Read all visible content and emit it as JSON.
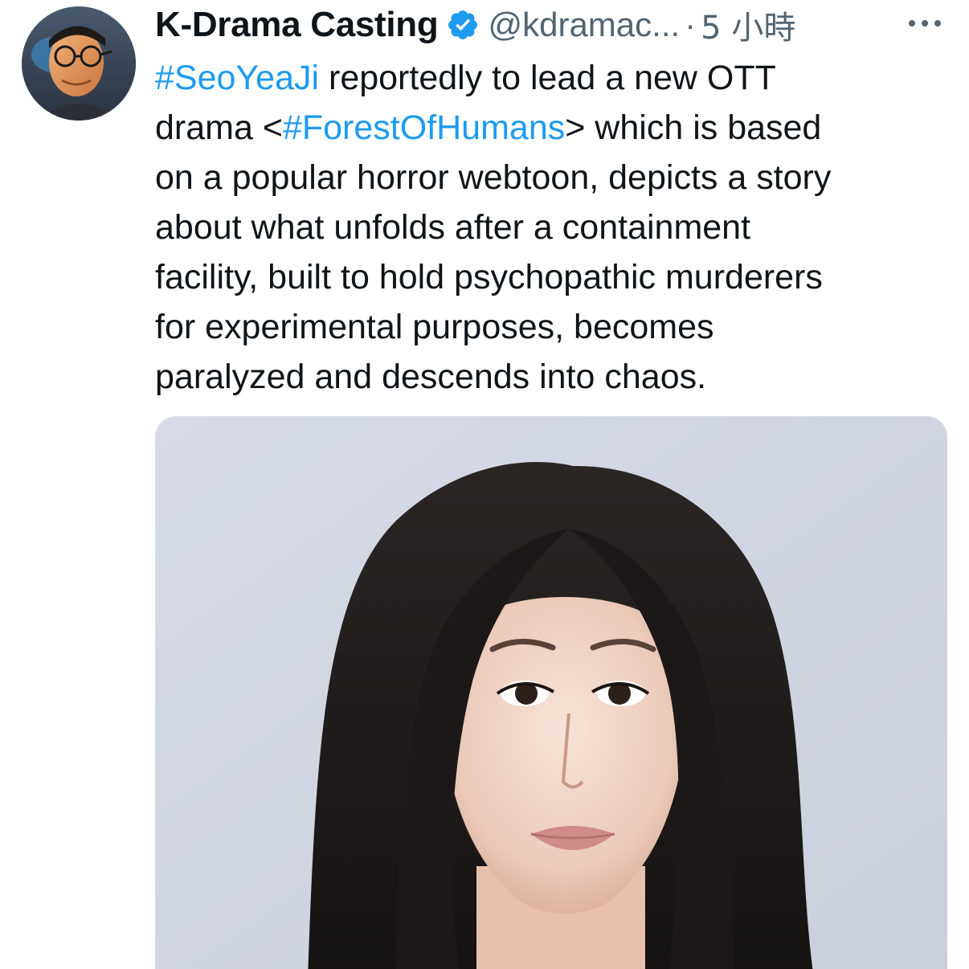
{
  "tweet": {
    "author": {
      "display_name": "K-Drama Casting",
      "handle": "@kdramac...",
      "verified": true,
      "avatar_icon": "avatar-photo"
    },
    "separator": "·",
    "time": "5 小時",
    "more_icon": "more-dots-icon",
    "text": {
      "lines": [
        [
          {
            "type": "hashtag",
            "value": "#SeoYeaJi"
          },
          {
            "type": "text",
            "value": " reportedly to lead a new OTT"
          }
        ],
        [
          {
            "type": "text",
            "value": "drama <"
          },
          {
            "type": "hashtag",
            "value": "#ForestOfHumans"
          },
          {
            "type": "text",
            "value": "> which is based"
          }
        ],
        [
          {
            "type": "text",
            "value": "on a popular horror webtoon, depicts a story"
          }
        ],
        [
          {
            "type": "text",
            "value": "about what unfolds after a containment"
          }
        ],
        [
          {
            "type": "text",
            "value": "facility, built to hold psychopathic murderers"
          }
        ],
        [
          {
            "type": "text",
            "value": "for experimental purposes, becomes"
          }
        ],
        [
          {
            "type": "text",
            "value": "paralyzed and descends into chaos."
          }
        ]
      ]
    },
    "media": {
      "kind": "photo",
      "subject": "portrait"
    }
  },
  "colors": {
    "text": "#0f1419",
    "secondary": "#536471",
    "link": "#1d9bf0",
    "verified": "#1d9bf0",
    "background": "#ffffff"
  }
}
